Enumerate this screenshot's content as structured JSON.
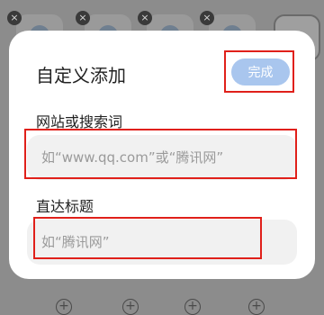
{
  "dialog": {
    "title": "自定义添加",
    "done_label": "完成",
    "url_label": "网站或搜索词",
    "url_placeholder": "如“www.qq.com”或“腾讯网”",
    "title_label": "直达标题",
    "title_placeholder": "如“腾讯网”"
  },
  "background": {
    "close_glyph": "×",
    "add_glyph": "+"
  },
  "colors": {
    "overlay": "#8c8c8c",
    "done_button": "#a9c6ee",
    "highlight": "#e0201a"
  },
  "icons": [
    "close-icon",
    "plus-icon",
    "add-circle-icon"
  ]
}
